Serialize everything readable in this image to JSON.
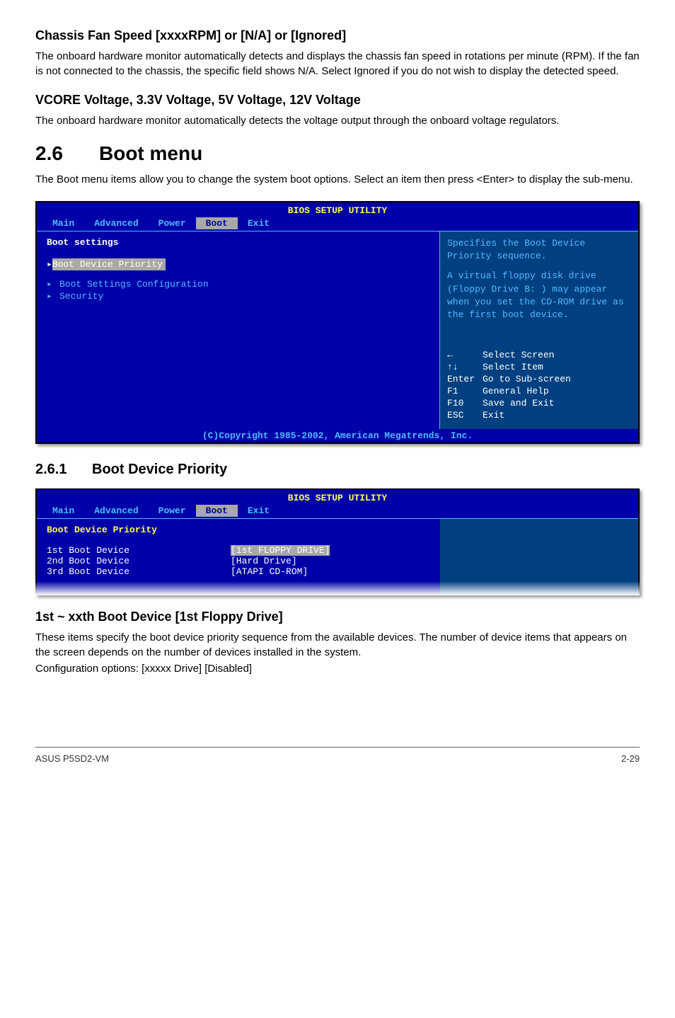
{
  "section1": {
    "heading": "Chassis Fan Speed [xxxxRPM] or [N/A] or [Ignored]",
    "body": "The onboard hardware monitor automatically detects and displays the chassis fan speed in rotations per minute (RPM). If the fan is not connected to the chassis, the specific field shows N/A. Select Ignored if you do not wish to display the detected speed."
  },
  "section2": {
    "heading": "VCORE Voltage, 3.3V Voltage, 5V Voltage, 12V Voltage",
    "body": "The onboard hardware monitor automatically detects the voltage output through the onboard voltage regulators."
  },
  "section3": {
    "num": "2.6",
    "title": "Boot menu",
    "body": "The Boot menu items allow you to change the system boot options. Select an item then press <Enter> to display the sub-menu."
  },
  "bios1": {
    "title": "BIOS SETUP UTILITY",
    "tabs": [
      "Main",
      "Advanced",
      "Power",
      "Boot",
      "Exit"
    ],
    "activeTab": "Boot",
    "heading": "Boot settings",
    "items": [
      {
        "label": "Boot Device Priority",
        "selected": true
      },
      {
        "label": "Boot Settings Configuration",
        "selected": false
      },
      {
        "label": "Security",
        "selected": false
      }
    ],
    "help": "Specifies the Boot Device Priority sequence.",
    "help2": "A virtual floppy disk drive (Floppy Drive B: ) may appear when you set the CD-ROM drive as the first boot device.",
    "nav": [
      {
        "key": "←",
        "label": "Select Screen"
      },
      {
        "key": "↑↓",
        "label": "Select Item"
      },
      {
        "key": "Enter",
        "label": "Go to Sub-screen"
      },
      {
        "key": "F1",
        "label": "General Help"
      },
      {
        "key": "F10",
        "label": "Save and Exit"
      },
      {
        "key": "ESC",
        "label": "Exit"
      }
    ],
    "copyright": "(C)Copyright 1985-2002, American Megatrends, Inc."
  },
  "section4": {
    "num": "2.6.1",
    "title": "Boot Device Priority"
  },
  "bios2": {
    "title": "BIOS SETUP UTILITY",
    "tabs": [
      "Main",
      "Advanced",
      "Power",
      "Boot",
      "Exit"
    ],
    "activeTab": "Boot",
    "heading": "Boot Device Priority",
    "devices": [
      {
        "label": "1st Boot Device",
        "value": "[1st FLOPPY DRIVE]",
        "selected": true
      },
      {
        "label": "2nd Boot Device",
        "value": "[Hard Drive]",
        "selected": false
      },
      {
        "label": "3rd Boot Device",
        "value": "[ATAPI CD-ROM]",
        "selected": false
      }
    ]
  },
  "section5": {
    "heading": "1st ~ xxth Boot Device [1st Floppy Drive]",
    "body1": "These items specify the boot device priority sequence from the available devices. The number of device items that appears on the screen depends on the number of devices installed in the system.",
    "body2": "Configuration options: [xxxxx Drive] [Disabled]"
  },
  "footer": {
    "left": "ASUS P5SD2-VM",
    "right": "2-29"
  }
}
